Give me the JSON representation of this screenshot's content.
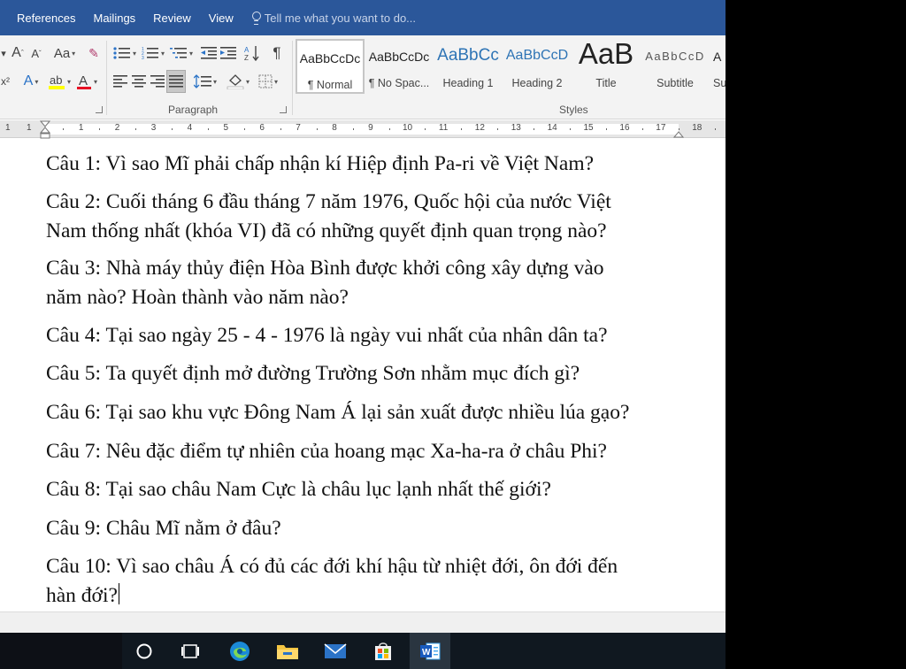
{
  "tabs": [
    "References",
    "Mailings",
    "Review",
    "View"
  ],
  "tell_me": {
    "placeholder": "Tell me what you want to do..."
  },
  "ribbon": {
    "paragraph_label": "Paragraph",
    "styles_label": "Styles",
    "styles": [
      {
        "preview": "AaBbCcDc",
        "name": "¶ Normal",
        "selected": true
      },
      {
        "preview": "AaBbCcDc",
        "name": "¶ No Spac..."
      },
      {
        "preview": "AaBbCc",
        "name": "Heading 1"
      },
      {
        "preview": "AaBbCcD",
        "name": "Heading 2"
      },
      {
        "preview": "AaB",
        "name": "Title"
      },
      {
        "preview": "AaBbCcD",
        "name": "Subtitle"
      },
      {
        "preview": "A",
        "name": "Su"
      }
    ]
  },
  "ruler": {
    "left_numbers": [
      "1",
      "1"
    ],
    "numbers": [
      "1",
      "2",
      "3",
      "4",
      "5",
      "6",
      "7",
      "8",
      "9",
      "10",
      "11",
      "12",
      "13",
      "14",
      "15",
      "16",
      "17",
      "18"
    ]
  },
  "document": {
    "questions": [
      [
        "Câu 1: Vì sao Mĩ phải chấp nhận kí Hiệp định Pa-ri về Việt Nam?"
      ],
      [
        "Câu 2: Cuối tháng 6 đầu tháng 7 năm 1976, Quốc hội của nước Việt",
        "Nam thống nhất (khóa VI) đã có những quyết định quan trọng nào?"
      ],
      [
        "Câu 3: Nhà máy thủy điện Hòa Bình được khởi công xây dựng vào",
        "năm nào? Hoàn thành vào năm nào?"
      ],
      [
        "Câu 4: Tại sao ngày 25 - 4 - 1976 là ngày vui nhất của nhân dân ta?"
      ],
      [
        "Câu 5: Ta quyết định mở đường Trường Sơn nhằm mục đích gì?"
      ],
      [
        "Câu 6: Tại sao khu vực Đông Nam Á lại sản xuất được nhiều lúa gạo?"
      ],
      [
        "Câu 7: Nêu đặc điểm tự nhiên của hoang mạc Xa-ha-ra ở châu Phi?"
      ],
      [
        "Câu 8: Tại sao châu Nam Cực là châu lục lạnh nhất thế giới?"
      ],
      [
        "Câu 9: Châu Mĩ nằm ở đâu?"
      ],
      [
        "Câu 10: Vì sao châu Á có đủ các đới khí hậu từ nhiệt đới, ôn đới đến",
        "hàn đới?"
      ]
    ]
  },
  "colors": {
    "title_bar": "#2b579a",
    "ribbon": "#f3f3f3",
    "taskbar": "#101820",
    "highlight": "#ffff00",
    "font_color": "#e81123"
  },
  "taskbar": {
    "items": [
      {
        "icon": "cortana-circle-icon"
      },
      {
        "icon": "task-view-icon"
      },
      {
        "icon": "edge-icon"
      },
      {
        "icon": "file-explorer-icon"
      },
      {
        "icon": "mail-icon"
      },
      {
        "icon": "store-icon"
      },
      {
        "icon": "word-icon",
        "active": true
      }
    ]
  }
}
